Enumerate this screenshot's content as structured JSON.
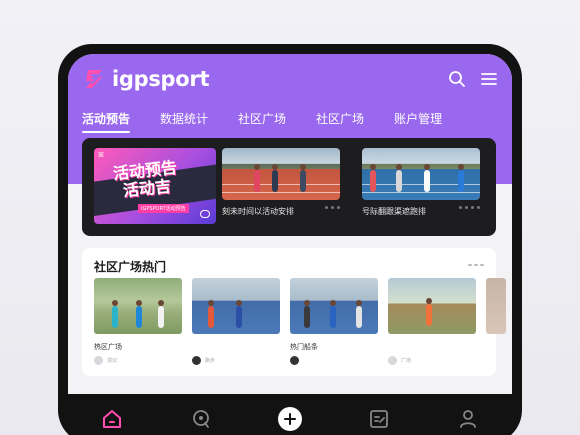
{
  "app": {
    "logo_text": "igpsport",
    "brand_color": "#9a68ee",
    "accent_pink": "#ff4fb0"
  },
  "header": {
    "icons": [
      "search-icon",
      "menu-icon"
    ]
  },
  "tabs": [
    {
      "label": "活动预告",
      "active": true
    },
    {
      "label": "数据统计",
      "active": false
    },
    {
      "label": "社区广场",
      "active": false
    },
    {
      "label": "社区广场",
      "active": false
    },
    {
      "label": "账户管理",
      "active": false
    }
  ],
  "banner": {
    "promo": {
      "title_line1": "活动预告",
      "title_line2": "活动吉",
      "subtitle": "IGPSPORT活动预告"
    },
    "cards": [
      {
        "caption": "刻未时间以活动安排"
      },
      {
        "caption": "号际翻跟渠遮跑排"
      }
    ]
  },
  "section": {
    "title": "社区广场热门",
    "items": [
      {
        "label": "热区广场",
        "meta": "漫识"
      },
      {
        "label": "",
        "meta": "跑步"
      },
      {
        "label": "热门船条",
        "meta": ""
      },
      {
        "label": "",
        "meta": "广场"
      }
    ]
  },
  "nav": {
    "items": [
      "home-icon",
      "discover-icon",
      "add-icon",
      "notes-icon",
      "profile-icon"
    ]
  }
}
